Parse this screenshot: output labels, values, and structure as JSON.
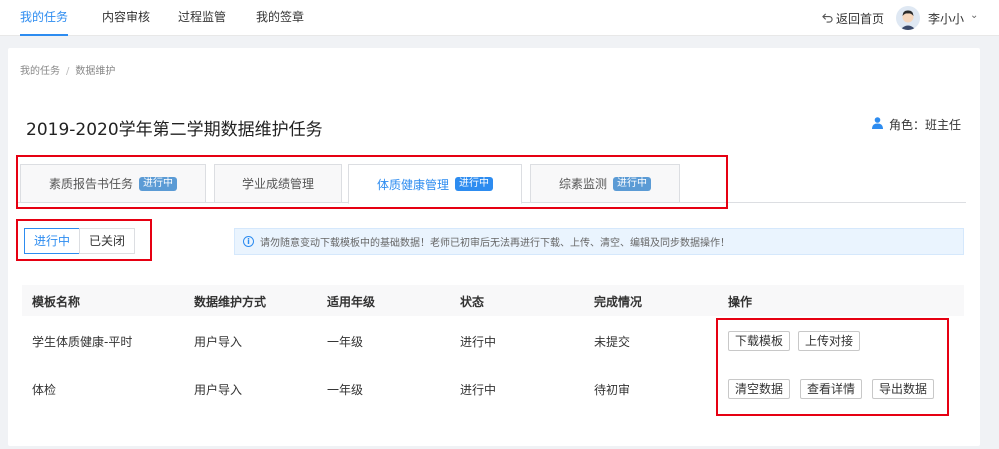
{
  "nav": {
    "items": [
      {
        "label": "我的任务"
      },
      {
        "label": "内容审核"
      },
      {
        "label": "过程监管"
      },
      {
        "label": "我的签章"
      }
    ],
    "back_home": "返回首页",
    "user_name": "李小小"
  },
  "breadcrumb": [
    "我的任务",
    "数据维护"
  ],
  "page_title": "2019-2020学年第二学期数据维护任务",
  "role": "角色：班主任",
  "tabs": [
    {
      "label": "素质报告书任务",
      "badge": "进行中"
    },
    {
      "label": "学业成绩管理",
      "badge": ""
    },
    {
      "label": "体质健康管理",
      "badge": "进行中"
    },
    {
      "label": "综素监测",
      "badge": "进行中"
    }
  ],
  "active_tab": 2,
  "status_filter": [
    "进行中",
    "已关闭"
  ],
  "notice": "请勿随意变动下载模板中的基础数据！老师已初审后无法再进行下载、上传、清空、编辑及同步数据操作！",
  "table": {
    "columns": [
      "模板名称",
      "数据维护方式",
      "适用年级",
      "状态",
      "完成情况",
      "操作"
    ],
    "rows": [
      {
        "name": "学生体质健康-平时",
        "method": "用户导入",
        "grade": "一年级",
        "status": "进行中",
        "progress": "未提交",
        "actions": [
          "下载模板",
          "上传对接"
        ]
      },
      {
        "name": "体检",
        "method": "用户导入",
        "grade": "一年级",
        "status": "进行中",
        "progress": "待初审",
        "actions": [
          "清空数据",
          "查看详情",
          "导出数据"
        ]
      }
    ]
  },
  "colors": {
    "accent": "#2d8cf0",
    "highlight_box": "#e60012",
    "badge": "#5b9bd5"
  }
}
